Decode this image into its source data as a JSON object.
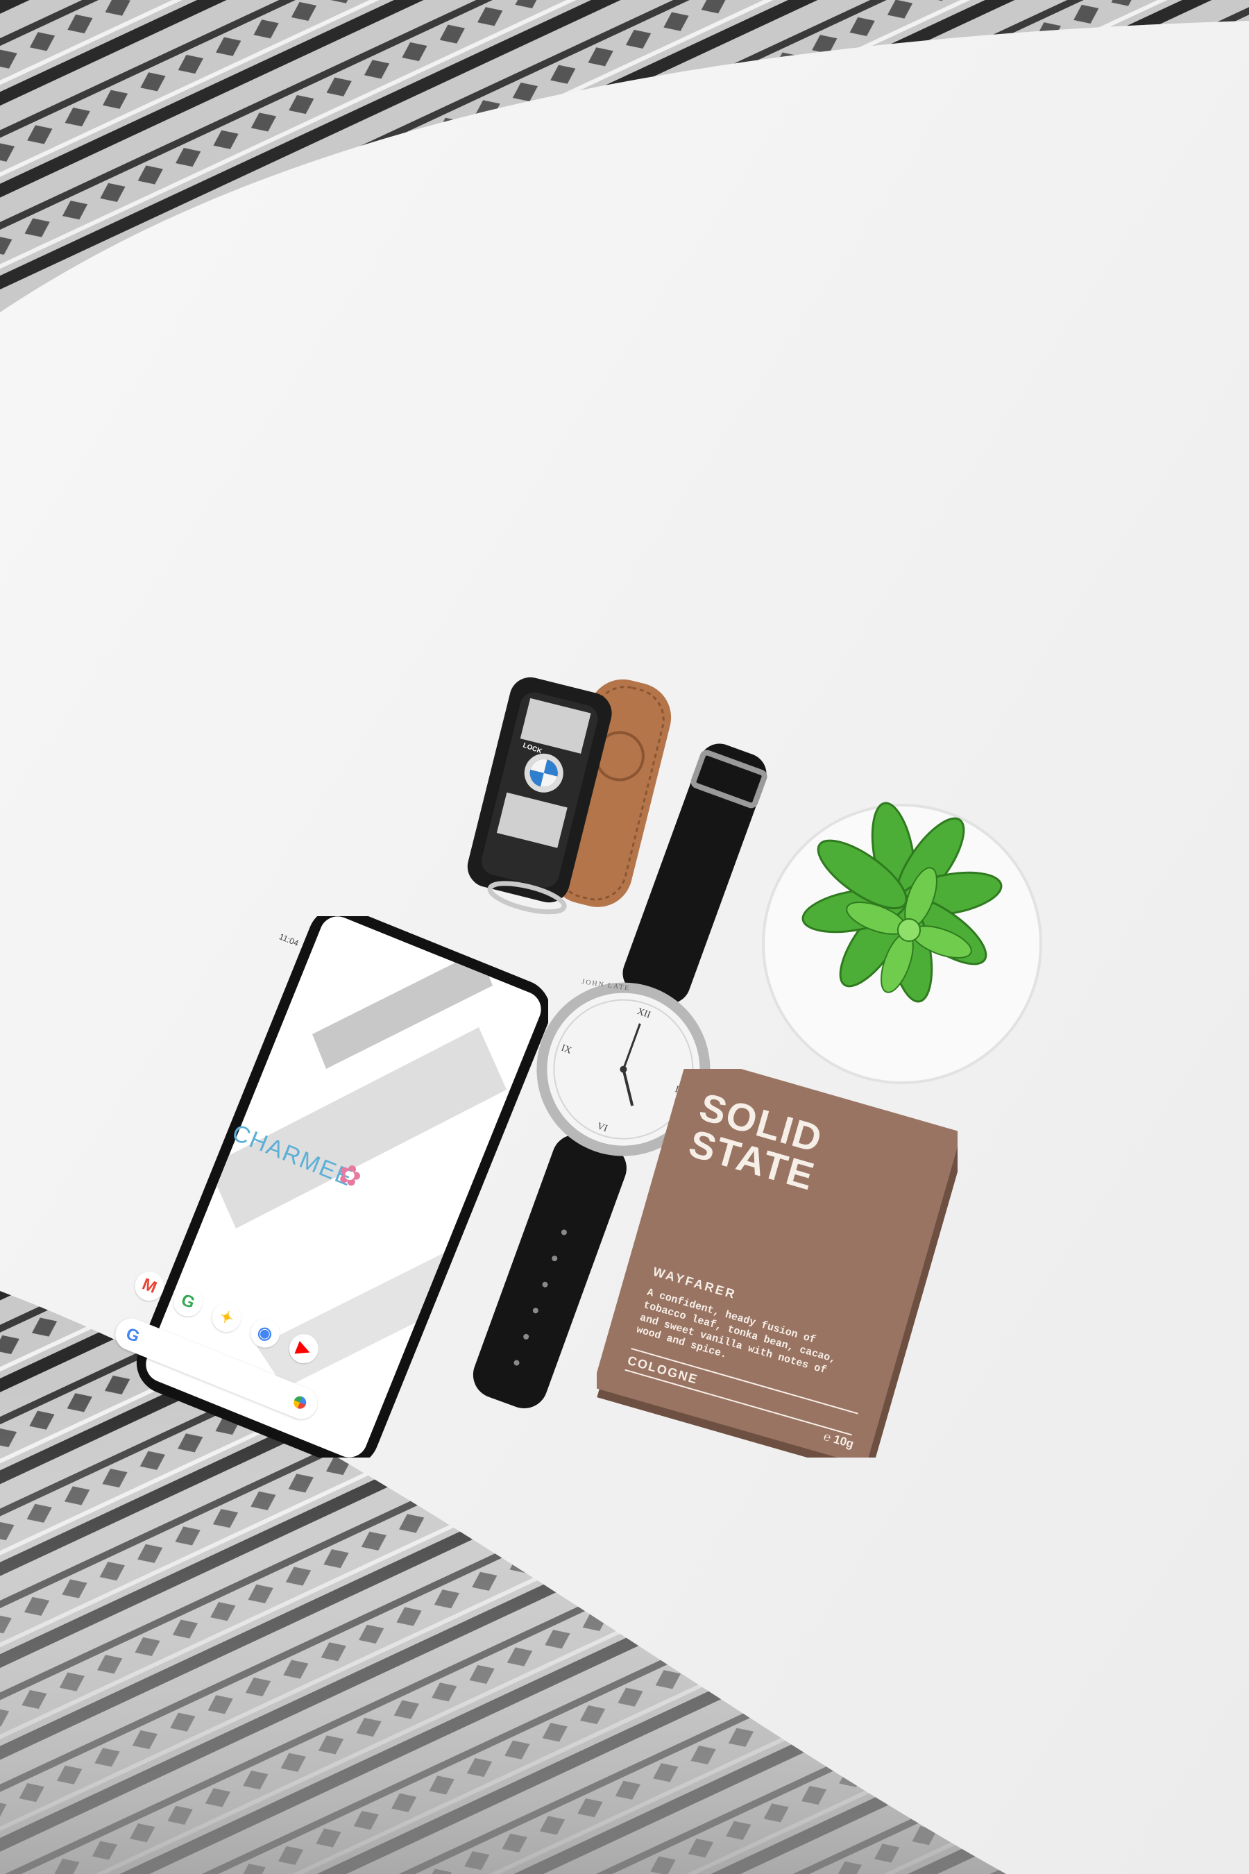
{
  "phone": {
    "status_time": "11:04",
    "brand": "CHARMEE",
    "brand_mark": "✿",
    "apps": [
      {
        "name": "gmail-app",
        "glyph": "M",
        "color": "#ea4335"
      },
      {
        "name": "maps-app",
        "glyph": "G",
        "color": "#34a853"
      },
      {
        "name": "photos-app",
        "glyph": "✦",
        "color": "#fbbc05"
      },
      {
        "name": "chrome-app",
        "glyph": "◉",
        "color": "#4285f4"
      },
      {
        "name": "youtube-app",
        "glyph": "▶",
        "color": "#ff0000"
      }
    ],
    "search_glyph": "G"
  },
  "keyfob": {
    "lock_label": "LOCK"
  },
  "watch": {
    "brand": "JOHN LATE"
  },
  "box": {
    "title_line1": "SOLID",
    "title_line2": "STATE",
    "subtitle": "WAYFARER",
    "description": "A confident, heady fusion of tobacco leaf, tonka bean, cacao, and sweet vanilla with notes of wood and spice.",
    "category": "COLOGNE",
    "weight": "℮ 10g"
  },
  "colors": {
    "table": "#f1f1f1",
    "box": "#9a7463",
    "leather": "#b5754a",
    "plant": "#4cae36",
    "phone_frame": "#111111"
  }
}
